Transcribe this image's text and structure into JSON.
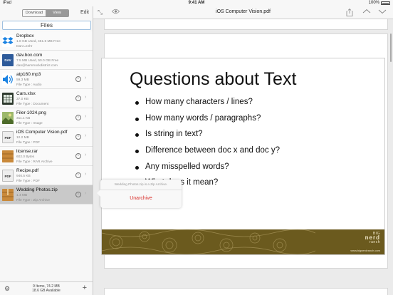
{
  "status_bar": {
    "carrier": "iPad",
    "time": "9:41 AM",
    "battery": "100%",
    "battery_level": 1.0
  },
  "sidebar": {
    "segments": [
      "Download",
      "View"
    ],
    "selected_segment": "View",
    "edit_label": "Edit",
    "header": "Files",
    "files": [
      {
        "icon": "dropbox-icon",
        "name": "Dropbox",
        "line1": "1.8 GB Used, 461.6 MB Free",
        "line2": "Dan Leehr",
        "info": "",
        "chevron": "",
        "icon_text": ""
      },
      {
        "icon": "dav-icon",
        "name": "dav.box.com",
        "line1": "7.5 MB Used, 50.0 GB Free",
        "line2": "dan@hammockdistrict.com",
        "info": "",
        "chevron": "",
        "icon_text": "DAV"
      },
      {
        "icon": "audio-icon",
        "name": "atp160.mp3",
        "line1": "59.3 MB",
        "line2": "File Type : Audio",
        "info": "i",
        "chevron": "›",
        "icon_text": ""
      },
      {
        "icon": "spreadsheet-icon",
        "name": "Cars.xlsx",
        "line1": "37.0 KB",
        "line2": "File Type : Document",
        "info": "i",
        "chevron": "›",
        "icon_text": ""
      },
      {
        "icon": "image-icon",
        "name": "Filer-1024.png",
        "line1": "311.1 KB",
        "line2": "File Type : Image",
        "info": "i",
        "chevron": "›",
        "icon_text": ""
      },
      {
        "icon": "pdf-icon",
        "name": "iOS Computer Vision.pdf",
        "line1": "12.2 MB",
        "line2": "File Type : PDF",
        "info": "i",
        "chevron": "›",
        "icon_text": "PDF"
      },
      {
        "icon": "archive-icon",
        "name": "license.rar",
        "line1": "602.0 Bytes",
        "line2": "File Type : RAR Archive",
        "info": "i",
        "chevron": "›",
        "icon_text": ""
      },
      {
        "icon": "pdf-icon",
        "name": "Recipe.pdf",
        "line1": "946.5 KB",
        "line2": "File Type : PDF",
        "info": "i",
        "chevron": "›",
        "icon_text": "PDF"
      },
      {
        "icon": "zip-icon",
        "name": "Wedding Photos.zip",
        "line1": "1.4 MB",
        "line2": "File Type : Zip Archive",
        "info": "i",
        "chevron": "›",
        "icon_text": ""
      }
    ],
    "selected_file": "Wedding Photos.zip",
    "footer": {
      "count": "9 Items, 74.2 MB",
      "available": "18.6 GB Available"
    }
  },
  "toolbar": {
    "title": "iOS Computer Vision.pdf"
  },
  "document": {
    "slide_title": "Questions about Text",
    "bullets": [
      "How many characters / lines?",
      "How many words / paragraphs?",
      "Is string in text?",
      "Difference between doc x and doc y?",
      "Any misspelled words?",
      "What does it mean?"
    ],
    "footer_brand_line1": "BIG",
    "footer_brand_line2": "nerd",
    "footer_brand_line3": "ranch",
    "footer_url": "www.bignerdranch.com"
  },
  "popover": {
    "message": "Wedding Photos.zip is a Zip Archive.",
    "action": "Unarchive"
  },
  "colors": {
    "accent": "#d9302c",
    "selected_row": "#c9c9c9",
    "slide_footer": "#6b5a1e"
  }
}
